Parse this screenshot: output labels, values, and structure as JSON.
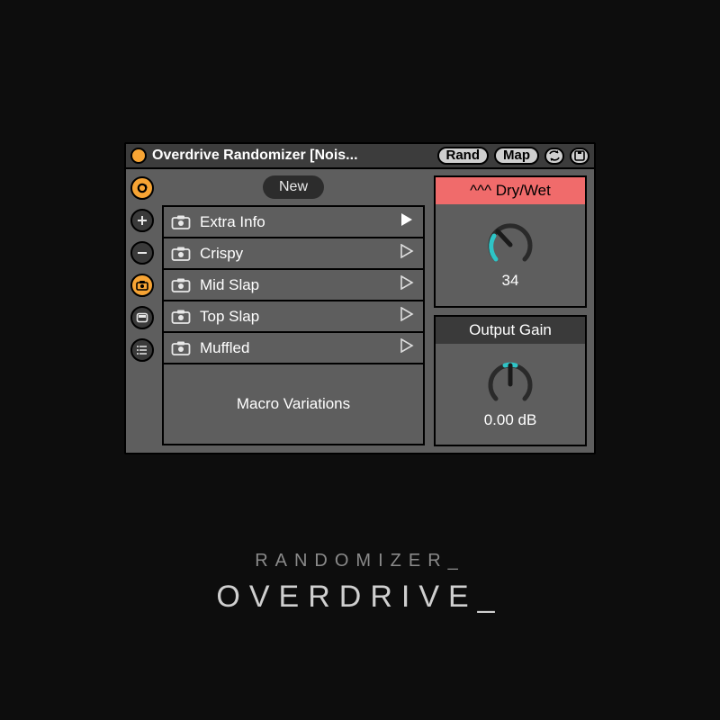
{
  "title": "Overdrive Randomizer [Nois...",
  "titlebar_buttons": {
    "rand": "Rand",
    "map": "Map"
  },
  "new_button": "New",
  "presets": [
    {
      "label": "Extra Info"
    },
    {
      "label": "Crispy"
    },
    {
      "label": "Mid Slap"
    },
    {
      "label": "Top Slap"
    },
    {
      "label": "Muffled"
    }
  ],
  "macro_footer": "Macro Variations",
  "params": {
    "drywet": {
      "label": "^^^ Dry/Wet",
      "value": "34",
      "knob_angle_deg": 205,
      "accent": "red"
    },
    "gain": {
      "label": "Output Gain",
      "value": "0.00 dB",
      "knob_angle_deg": 265,
      "accent": "dark"
    }
  },
  "caption": {
    "line1": "RANDOMIZER_",
    "line2": "OVERDRIVE_"
  },
  "colors": {
    "orange": "#f7a434",
    "red": "#f06b6b",
    "teal": "#2ec4c6"
  }
}
